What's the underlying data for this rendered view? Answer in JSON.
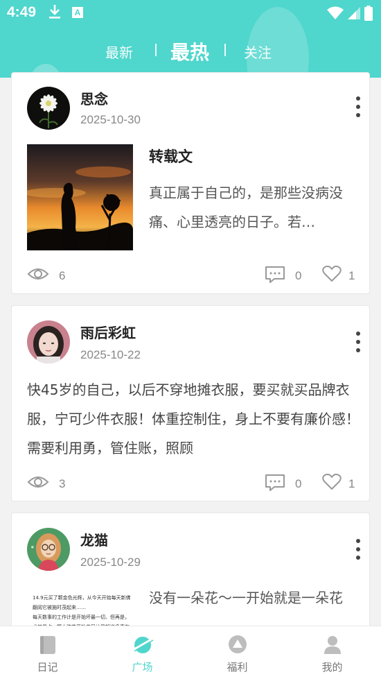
{
  "status_bar": {
    "time": "4:49",
    "notification_icon_letter": "A"
  },
  "tabs": [
    {
      "label": "最新",
      "active": false
    },
    {
      "label": "最热",
      "active": true
    },
    {
      "label": "关注",
      "active": false
    }
  ],
  "posts": [
    {
      "user": "思念",
      "date": "2025-10-30",
      "title": "转载文",
      "excerpt": "真正属于自己的，是那些没病没痛、心里透亮的日子。若…",
      "views": "6",
      "comments": "0",
      "likes": "1"
    },
    {
      "user": "雨后彩虹",
      "date": "2025-10-22",
      "text": "快45岁的自己，以后不穿地摊衣服，要买就买品牌衣服，宁可少件衣服！体重控制住，身上不要有廉价感！需要利用勇，管住账，照顾",
      "views": "3",
      "comments": "0",
      "likes": "1"
    },
    {
      "user": "龙猫",
      "date": "2025-10-29",
      "excerpt": "没有一朵花～一开始就是一朵花",
      "thumb_lines": [
        "14.9元买了颗金色光辉，从今天开始每天新佛",
        "翻阅它被施时茂起来……",
        "每天数事的工作计是开始坏最一切、但再是，",
        "尤其是点一颗小孩苗开始养又让我知道多事在"
      ]
    }
  ],
  "bottom_nav": [
    {
      "label": "日记",
      "icon": "diary-icon",
      "active": false
    },
    {
      "label": "广场",
      "icon": "planet-icon",
      "active": true
    },
    {
      "label": "福利",
      "icon": "welfare-icon",
      "active": false
    },
    {
      "label": "我的",
      "icon": "profile-icon",
      "active": false
    }
  ],
  "colors": {
    "accent": "#4fd6cd",
    "background": "#f2f2f2"
  }
}
